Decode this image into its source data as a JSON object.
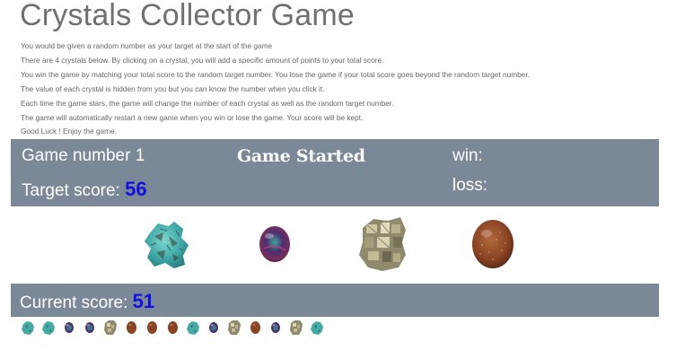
{
  "title": "Crystals Collector Game",
  "instructions": [
    "You would be given a random number as your target at the start of the game",
    "There are 4 crystals below. By clicking on a crystal, you will add a specific amount of points to your total score.",
    "You win the game by matching your total score to the random target number. You lose the game if your total score goes beyond the random target number.",
    "The value of each crystal is hidden from you but you can know the number when you click it.",
    "Each time the game stars, the game will change the number of each crystal as well as the random target number.",
    "The game will automatically restart a new game when you win or lose the game. Your score will be kept.",
    "Good Luck ! Enjoy the game."
  ],
  "scoreboard": {
    "game_number_label": "Game number 1",
    "status": "Game Started",
    "target_label": "Target score:",
    "target_value": "56",
    "win_label": "win:",
    "loss_label": "loss:"
  },
  "crystals": [
    "turquoise-crystal",
    "fluorite-crystal",
    "pyrite-crystal",
    "goldstone-crystal"
  ],
  "current": {
    "label": "Current score:",
    "value": "51"
  },
  "history": [
    "turquoise",
    "turquoise",
    "fluorite",
    "fluorite",
    "pyrite",
    "goldstone",
    "goldstone",
    "goldstone",
    "turquoise",
    "fluorite",
    "pyrite",
    "goldstone",
    "fluorite",
    "pyrite",
    "turquoise"
  ],
  "colors": {
    "panel": "#7b8897",
    "score_number": "#1210e0"
  }
}
